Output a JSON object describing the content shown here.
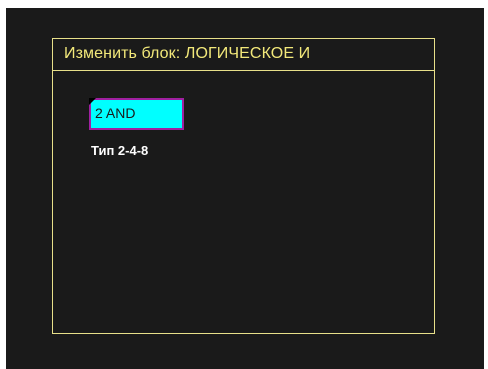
{
  "dialog": {
    "title": "Изменить блок:  ЛОГИЧЕСКОЕ И"
  },
  "block": {
    "label": "2 AND",
    "type_text": "Тип 2-4-8"
  },
  "colors": {
    "screen_background": "#1a1a1a",
    "frame_border": "#e8e08a",
    "title_text": "#f2e87a",
    "block_fill": "#00ffff",
    "block_border": "#a020a0",
    "type_text": "#ffffff"
  }
}
